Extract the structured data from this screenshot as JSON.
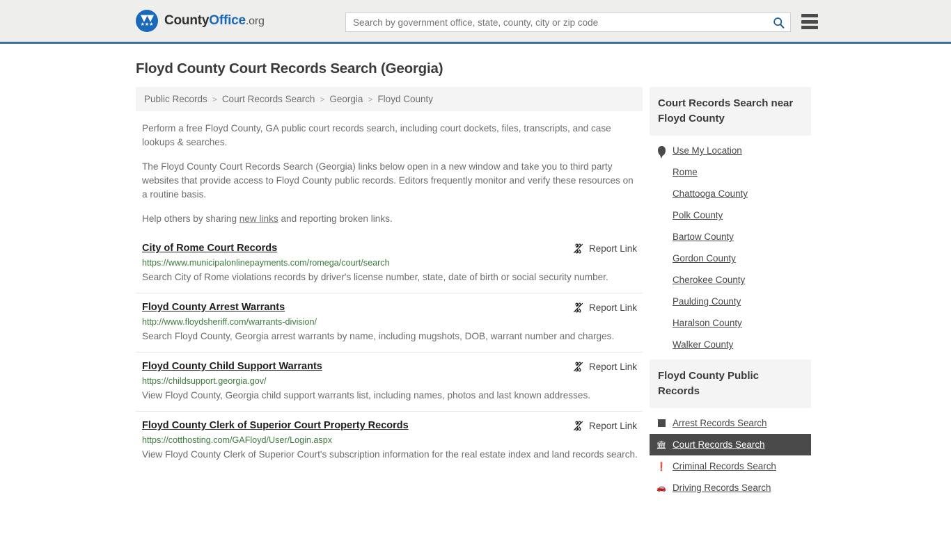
{
  "header": {
    "logo": {
      "name_part1": "County",
      "name_part2": "Office",
      "suffix": ".org",
      "eagle_icon": "eagle-icon",
      "stars": "★★★"
    },
    "search": {
      "placeholder": "Search by government office, state, county, city or zip code",
      "value": "",
      "search_icon": "search-icon"
    },
    "menu_icon": "hamburger-menu-icon"
  },
  "page": {
    "title": "Floyd County Court Records Search (Georgia)"
  },
  "breadcrumb": {
    "separator": ">",
    "items": [
      {
        "label": "Public Records"
      },
      {
        "label": "Court Records Search"
      },
      {
        "label": "Georgia"
      },
      {
        "label": "Floyd County"
      }
    ]
  },
  "intro": {
    "p1": "Perform a free Floyd County, GA public court records search, including court dockets, files, transcripts, and case lookups & searches.",
    "p2": "The Floyd County Court Records Search (Georgia) links below open in a new window and take you to third party websites that provide access to Floyd County public records. Editors frequently monitor and verify these resources on a routine basis.",
    "p3_before": "Help others by sharing ",
    "p3_link": "new links",
    "p3_after": " and reporting broken links."
  },
  "report_link_label": "Report Link",
  "report_link_icon": "broken-link-icon",
  "results": [
    {
      "title": "City of Rome Court Records",
      "url": "https://www.municipalonlinepayments.com/romega/court/search",
      "description": "Search City of Rome violations records by driver's license number, state, date of birth or social security number."
    },
    {
      "title": "Floyd County Arrest Warrants",
      "url": "http://www.floydsheriff.com/warrants-division/",
      "description": "Search Floyd County, Georgia arrest warrants by name, including mugshots, DOB, warrant number and charges."
    },
    {
      "title": "Floyd County Child Support Warrants",
      "url": "https://childsupport.georgia.gov/",
      "description": "View Floyd County, Georgia child support warrants list, including names, photos and last known addresses."
    },
    {
      "title": "Floyd County Clerk of Superior Court Property Records",
      "url": "https://cotthosting.com/GAFloyd/User/Login.aspx",
      "description": "View Floyd County Clerk of Superior Court's subscription information for the real estate index and land records search."
    }
  ],
  "sidebar": {
    "nearby": {
      "heading": "Court Records Search near Floyd County",
      "items": [
        {
          "label": "Use My Location",
          "icon": "map-pin-icon"
        },
        {
          "label": "Rome",
          "icon": ""
        },
        {
          "label": "Chattooga County",
          "icon": ""
        },
        {
          "label": "Polk County",
          "icon": ""
        },
        {
          "label": "Bartow County",
          "icon": ""
        },
        {
          "label": "Gordon County",
          "icon": ""
        },
        {
          "label": "Cherokee County",
          "icon": ""
        },
        {
          "label": "Paulding County",
          "icon": ""
        },
        {
          "label": "Haralson County",
          "icon": ""
        },
        {
          "label": "Walker County",
          "icon": ""
        }
      ]
    },
    "public_records": {
      "heading": "Floyd County Public Records",
      "items": [
        {
          "label": "Arrest Records Search",
          "icon": "square-icon",
          "active": false
        },
        {
          "label": "Court Records Search",
          "icon": "bank-icon",
          "active": true
        },
        {
          "label": "Criminal Records Search",
          "icon": "exclamation-icon",
          "active": false
        },
        {
          "label": "Driving Records Search",
          "icon": "car-icon",
          "active": false
        }
      ]
    }
  },
  "colors": {
    "header_bg": "#eeeeec",
    "header_border": "#3a6ea5",
    "brand_blue": "#1a69b8",
    "url_green": "#3c7a3c",
    "active_bg": "#4a4a4a",
    "panel_bg": "#f4f4f4"
  }
}
